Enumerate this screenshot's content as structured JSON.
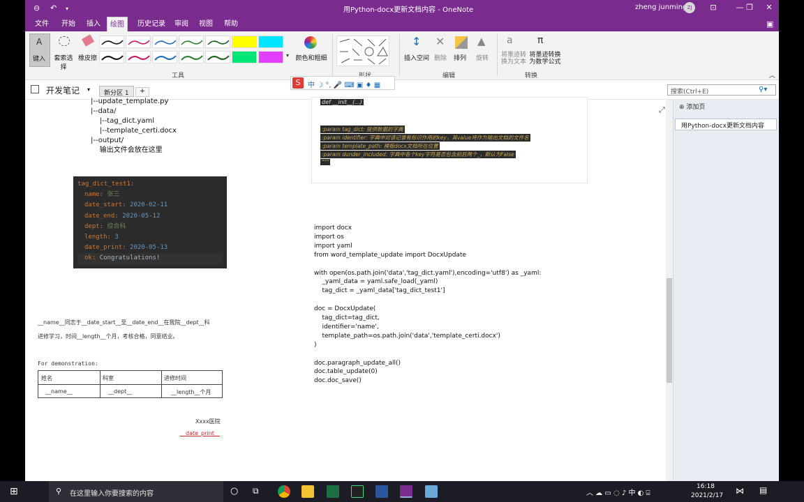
{
  "window": {
    "title": "用Python-docx更新文档内容 - OneNote",
    "user": "zheng junming",
    "user_initials": "ZJ"
  },
  "menu": [
    "文件",
    "开始",
    "插入",
    "绘图",
    "历史记录",
    "审阅",
    "视图",
    "帮助"
  ],
  "ribbon": {
    "type_label": "键入",
    "lasso_label": "套索选择",
    "eraser_label": "橡皮擦",
    "color_label": "颜色和粗细",
    "insert_space": "插入空间",
    "delete": "删除",
    "arrange": "排列",
    "rotate": "旋转",
    "ink_to_text": "将墨迹转\n换为文本",
    "ink_to_math": "将墨迹转换\n为数学公式",
    "groups": {
      "tools": "工具",
      "shapes": "形状",
      "edit": "编辑",
      "convert": "转换"
    }
  },
  "notebook": {
    "name": "开发笔记",
    "section": "新分区 1",
    "add_tab": "+"
  },
  "search": {
    "placeholder": "搜索(Ctrl+E)"
  },
  "pages": {
    "add_page": "添加页",
    "items": [
      "用Python-docx更新文档内容"
    ]
  },
  "tree_lines": [
    "|--update_template.py",
    "|--data/",
    "    |--tag_dict.yaml",
    "    |--template_certi.docx",
    "|--output/",
    "    输出文件会放在这里"
  ],
  "yaml": {
    "root": "tag_dict_test1:",
    "entries": [
      {
        "k": "name",
        "v": "张三",
        "t": "str"
      },
      {
        "k": "date_start",
        "v": "2020-02-11",
        "t": "num"
      },
      {
        "k": "date_end",
        "v": "2020-05-12",
        "t": "num"
      },
      {
        "k": "dept",
        "v": "综合科",
        "t": "str"
      },
      {
        "k": "length",
        "v": "3",
        "t": "num"
      },
      {
        "k": "date_print",
        "v": "2020-05-13",
        "t": "num"
      },
      {
        "k": "ok",
        "v": "Congratulations!",
        "t": "plain"
      }
    ]
  },
  "template_doc": {
    "line1": "__name__同志于__date_start__至__date_end__在我院__dept__科",
    "line2": "进修学习，时间__length__个月，考核合格，同意结业。",
    "demo": "For demonstration:",
    "headers": [
      "姓名",
      "科室",
      "进修时间"
    ],
    "cells": [
      "__name__",
      "__dept__",
      "__length__个月"
    ],
    "sign": "Xxxx医院",
    "date": "__date_print__"
  },
  "docstring": {
    "top": "def __init__(...)",
    "lines": [
      ":param tag_dict: 提供数据的字典",
      ":param identifier: 字典中对该记录有标识作用的key，其value将作为输出文档的文件名",
      ":param template_path: 模板docx文档所在位置",
      ":param dunder_included: 字典中各个key字符是否包含前后两个_，默认为False",
      "\"\"\""
    ]
  },
  "code_lines": [
    "import docx",
    "import os",
    "import yaml",
    "from word_template_update import DocxUpdate",
    "",
    "with open(os.path.join('data','tag_dict.yaml'),encoding='utf8') as _yaml:",
    "    _yaml_data = yaml.safe_load(_yaml)",
    "    tag_dict = _yaml_data['tag_dict_test1']",
    "",
    "doc = DocxUpdate(",
    "    tag_dict=tag_dict,",
    "    identifier='name',",
    "    template_path=os.path.join('data','template_certi.docx')",
    ")",
    "",
    "doc.paragraph_update_all()",
    "doc.table_update(0)",
    "doc.doc_save()"
  ],
  "taskbar": {
    "search_placeholder": "在这里输入你要搜索的内容",
    "time": "16:18",
    "date": "2021/2/17",
    "ime": "中"
  },
  "colors": {
    "brand": "#7a2b8e",
    "code_bg": "#2b2b2b"
  }
}
